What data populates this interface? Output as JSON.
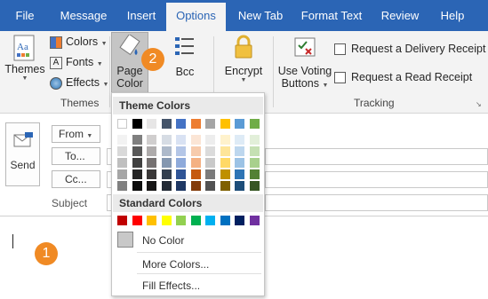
{
  "tabs": [
    "File",
    "Message",
    "Insert",
    "Options",
    "New Tab",
    "Format Text",
    "Review",
    "Help"
  ],
  "active_tab": "Options",
  "ribbon": {
    "themes": {
      "label": "Themes",
      "colors": "Colors",
      "fonts": "Fonts",
      "effects": "Effects",
      "group_label": "Themes"
    },
    "page_color": {
      "line1": "Page",
      "line2": "Color"
    },
    "bcc": "Bcc",
    "encrypt": "Encrypt",
    "voting": {
      "line1": "Use Voting",
      "line2": "Buttons"
    },
    "delivery_receipt": "Request a Delivery Receipt",
    "read_receipt": "Request a Read Receipt",
    "tracking_label": "Tracking"
  },
  "compose": {
    "send": "Send",
    "from": "From",
    "to": "To...",
    "cc": "Cc...",
    "subject": "Subject"
  },
  "dropdown": {
    "theme_colors": "Theme Colors",
    "standard_colors": "Standard Colors",
    "no_color": "No Color",
    "more_colors": "More Colors...",
    "fill_effects": "Fill Effects...",
    "theme_top": [
      "#ffffff",
      "#000000",
      "#e7e6e6",
      "#44546a",
      "#4472c4",
      "#ed7d31",
      "#a5a5a5",
      "#ffc000",
      "#5b9bd5",
      "#70ad47"
    ],
    "theme_shades": [
      [
        "#f2f2f2",
        "#d9d9d9",
        "#bfbfbf",
        "#a6a6a6",
        "#808080"
      ],
      [
        "#7f7f7f",
        "#595959",
        "#404040",
        "#262626",
        "#0d0d0d"
      ],
      [
        "#d0cece",
        "#aeabab",
        "#757171",
        "#3a3838",
        "#171616"
      ],
      [
        "#d6dce4",
        "#adb9ca",
        "#8497b0",
        "#333f4f",
        "#222a35"
      ],
      [
        "#d9e2f3",
        "#b4c6e7",
        "#8eaadb",
        "#2f5496",
        "#1f3864"
      ],
      [
        "#fbe5d5",
        "#f7cbac",
        "#f4b183",
        "#c55a11",
        "#833c0b"
      ],
      [
        "#ededed",
        "#dbdbdb",
        "#c9c9c9",
        "#7b7b7b",
        "#525252"
      ],
      [
        "#fff2cc",
        "#fee599",
        "#ffd966",
        "#bf9000",
        "#7f6000"
      ],
      [
        "#deebf6",
        "#bdd7ee",
        "#9cc3e5",
        "#2e75b5",
        "#1e4e79"
      ],
      [
        "#e2efd9",
        "#c5e0b3",
        "#a8d08d",
        "#538135",
        "#375623"
      ]
    ],
    "standard": [
      "#c00000",
      "#ff0000",
      "#ffc000",
      "#ffff00",
      "#92d050",
      "#00b050",
      "#00b0f0",
      "#0070c0",
      "#002060",
      "#7030a0"
    ]
  },
  "badges": {
    "one": "1",
    "two": "2"
  },
  "colors": {
    "accent": "#2b65b5",
    "badge": "#f08a24"
  }
}
